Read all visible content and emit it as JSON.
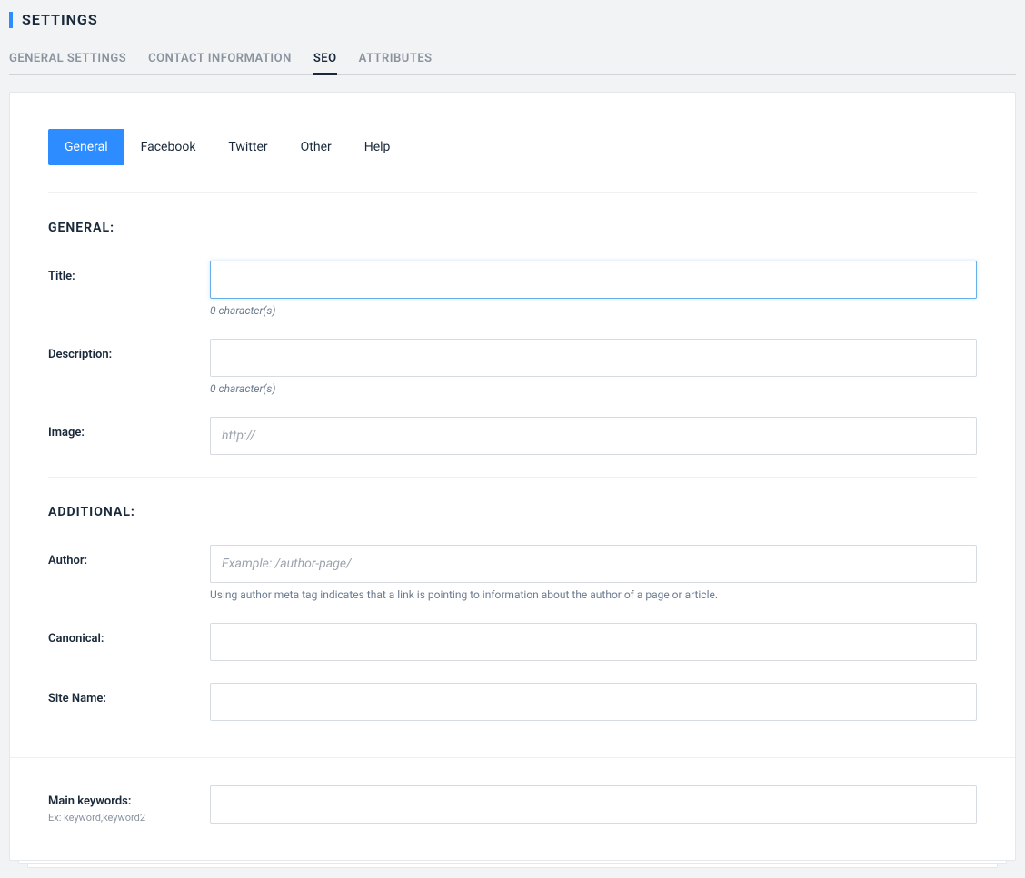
{
  "header": {
    "title": "SETTINGS"
  },
  "topTabs": [
    {
      "label": "GENERAL SETTINGS",
      "active": false
    },
    {
      "label": "CONTACT INFORMATION",
      "active": false
    },
    {
      "label": "SEO",
      "active": true
    },
    {
      "label": "ATTRIBUTES",
      "active": false
    }
  ],
  "innerTabs": [
    {
      "label": "General",
      "active": true
    },
    {
      "label": "Facebook",
      "active": false
    },
    {
      "label": "Twitter",
      "active": false
    },
    {
      "label": "Other",
      "active": false
    },
    {
      "label": "Help",
      "active": false
    }
  ],
  "sections": {
    "general": {
      "heading": "GENERAL:",
      "title": {
        "label": "Title:",
        "value": "",
        "counter": "0 character(s)"
      },
      "description": {
        "label": "Description:",
        "value": "",
        "counter": "0 character(s)"
      },
      "image": {
        "label": "Image:",
        "value": "",
        "placeholder": "http://"
      }
    },
    "additional": {
      "heading": "ADDITIONAL:",
      "author": {
        "label": "Author:",
        "value": "",
        "placeholder": "Example: /author-page/",
        "help": "Using author meta tag indicates that a link is pointing to information about the author of a page or article."
      },
      "canonical": {
        "label": "Canonical:",
        "value": ""
      },
      "siteName": {
        "label": "Site Name:",
        "value": ""
      }
    },
    "keywords": {
      "label": "Main keywords:",
      "sublabel": "Ex: keyword,keyword2",
      "value": ""
    }
  }
}
